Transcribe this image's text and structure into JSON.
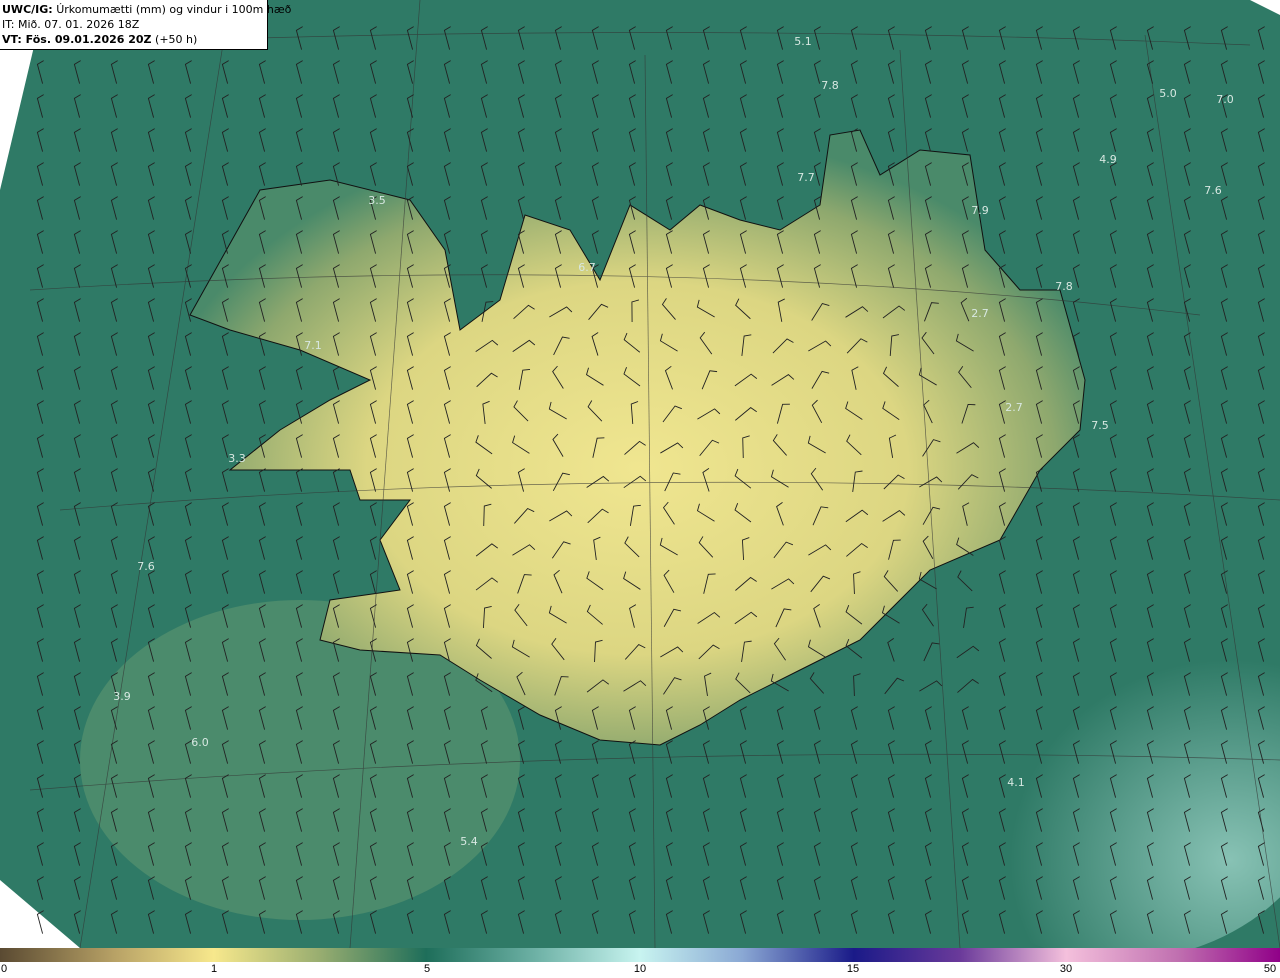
{
  "header": {
    "model": "UWC/IG:",
    "title": "Úrkomumætti (mm) og vindur i 100m hæð",
    "init_time": "IT: Mið. 07. 01. 2026 18Z",
    "valid_label": "VT: Fös. 09.01.2026 20Z",
    "lead": "(+50 h)"
  },
  "colorbar": {
    "ticks": [
      "0",
      "1",
      "5",
      "10",
      "15",
      "30",
      "50"
    ],
    "colors": [
      "#5a4a32",
      "#f7e88c",
      "#1e6e5a",
      "#c8f4f0",
      "#1a1a88",
      "#f4c0dc",
      "#900088"
    ]
  },
  "map_labels": [
    "5.1",
    "7.8",
    "5.0",
    "7.0",
    "4.9",
    "7.6",
    "7.7",
    "7.9",
    "3.5",
    "6.7",
    "7.8",
    "2.7",
    "7.1",
    "2.7",
    "7.5",
    "3.3",
    "7.6",
    "3.9",
    "6.0",
    "5.4",
    "4.1"
  ],
  "colors": {
    "sea": "#2f7a66",
    "land_low": "#e8e08a",
    "land_mid": "#9fb070",
    "coast": "#111111"
  }
}
